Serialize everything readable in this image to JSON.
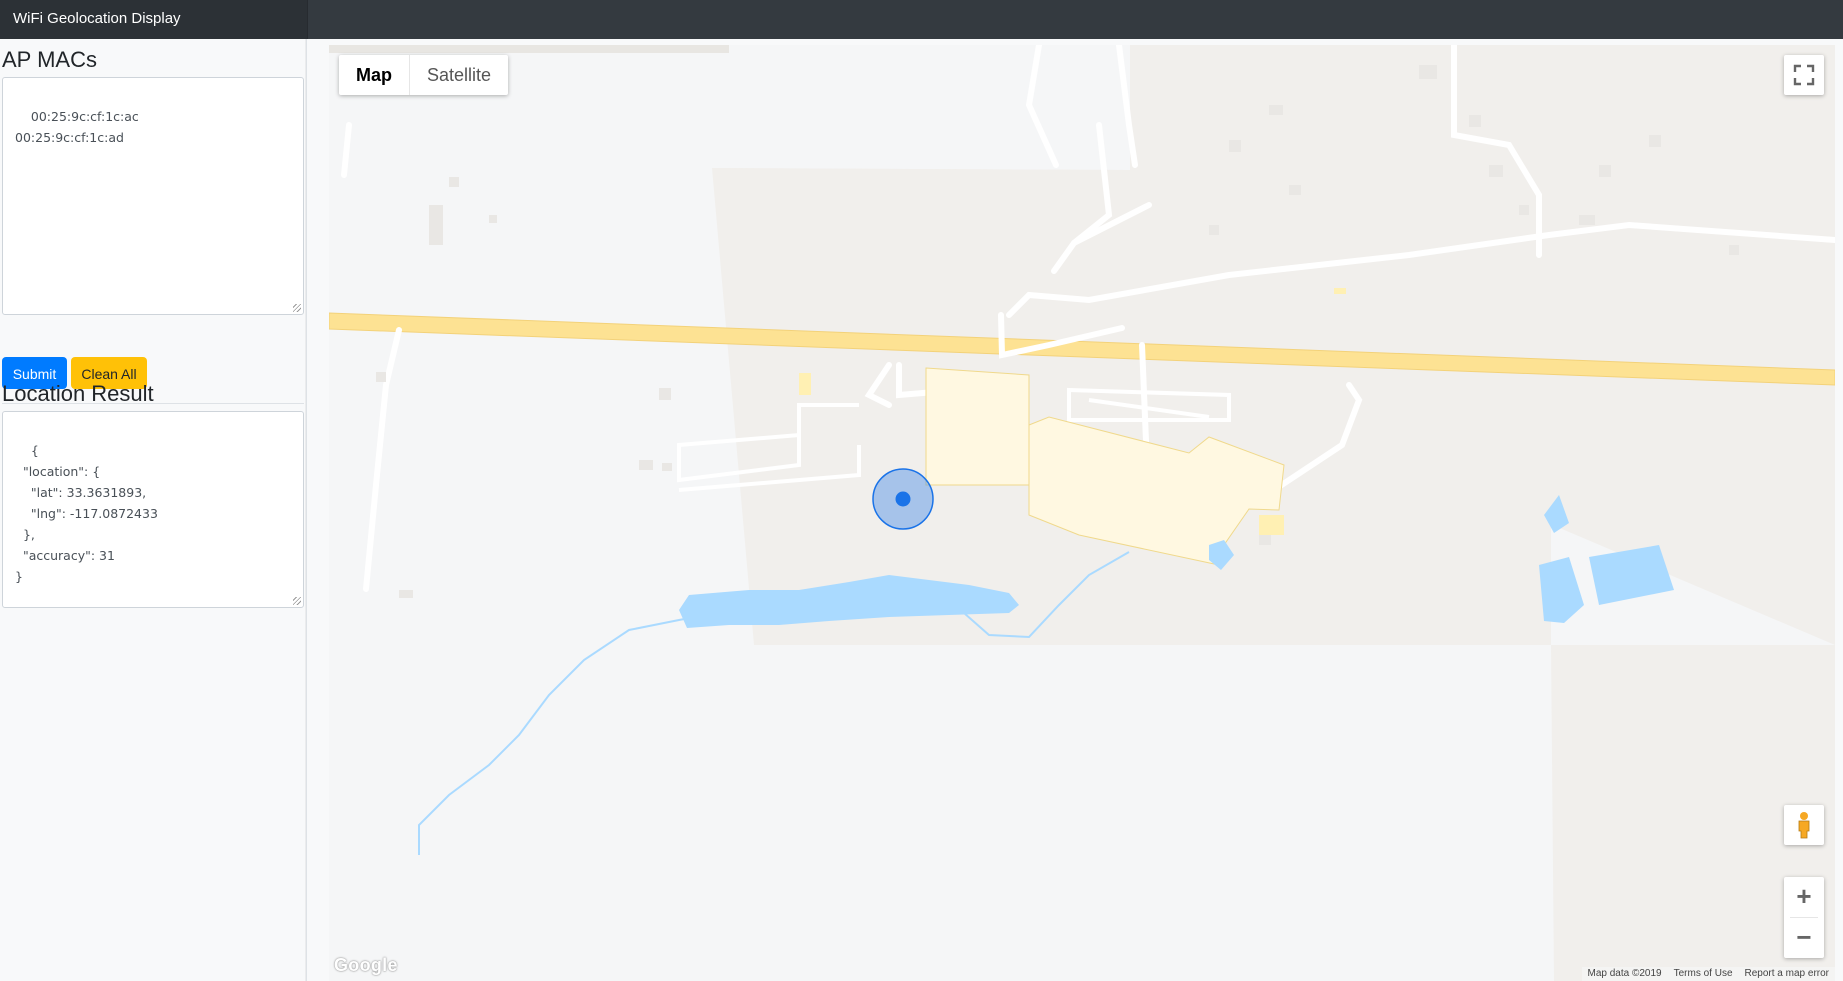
{
  "app": {
    "title": "WiFi Geolocation Display"
  },
  "sidebar": {
    "macs_heading": "AP MACs",
    "macs_value": "00:25:9c:cf:1c:ac\n00:25:9c:cf:1c:ad",
    "submit_label": "Submit",
    "clean_label": "Clean All",
    "result_heading": "Location Result",
    "result_value": "{\n  \"location\": {\n    \"lat\": 33.3631893,\n    \"lng\": -117.0872433\n  },\n  \"accuracy\": 31\n}"
  },
  "map": {
    "type_map_label": "Map",
    "type_satellite_label": "Satellite",
    "zoom_in_label": "+",
    "zoom_out_label": "−",
    "logo_text": "Google",
    "attribution": {
      "map_data": "Map data ©2019",
      "terms": "Terms of Use",
      "report": "Report a map error"
    },
    "marker": {
      "lat": 33.3631893,
      "lng": -117.0872433,
      "accuracy_m": 31,
      "color": "#1a73e8"
    },
    "colors": {
      "highway": "#fde293",
      "water": "#aadaff",
      "building": "#fff8e1",
      "land": "#f1efec"
    }
  }
}
